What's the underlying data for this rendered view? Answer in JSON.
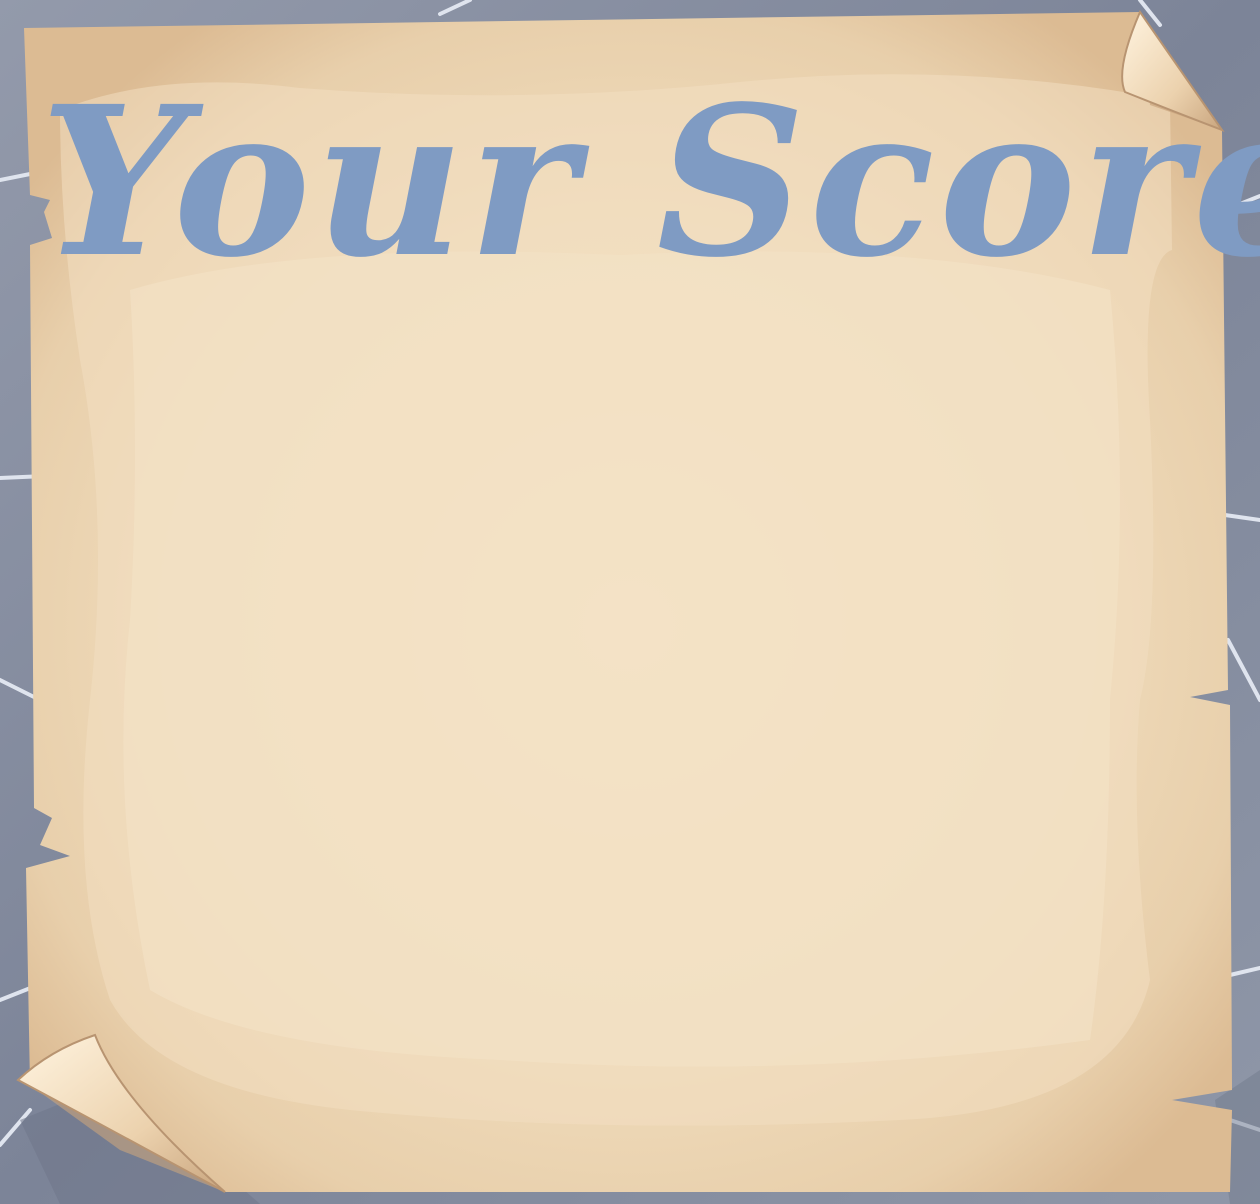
{
  "title": "Your Score",
  "colors": {
    "stone_background": "#8a93a6",
    "stone_crack": "#dfe4ee",
    "parchment_outer": "#e1c29c",
    "parchment_inner": "#f4e3c7",
    "title_text": "#7f9bc3"
  },
  "decorations": {
    "top_right_corner": "curled-page-corner",
    "bottom_left_corner": "curled-page-corner"
  }
}
